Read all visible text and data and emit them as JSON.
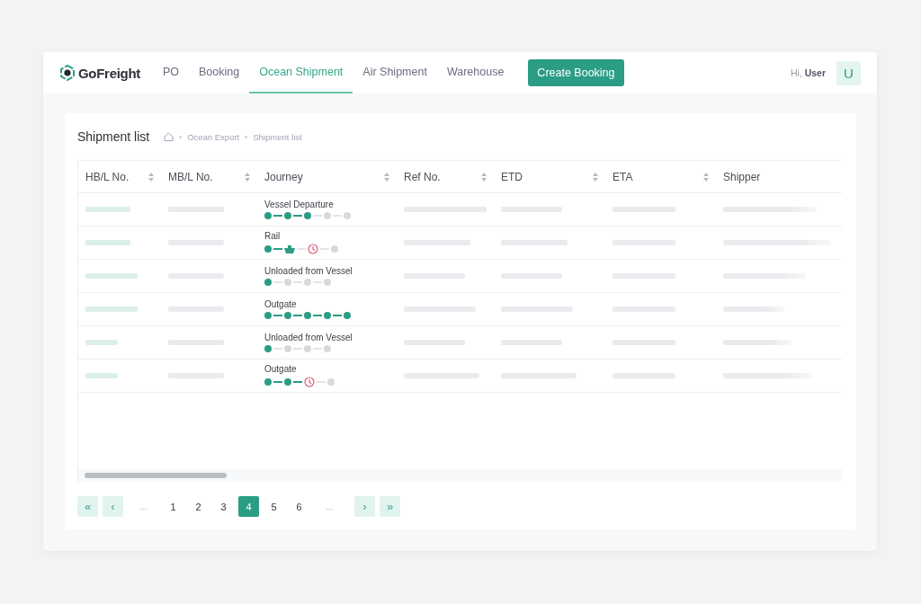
{
  "header": {
    "logo": "GoFreight",
    "tabs": [
      {
        "label": "PO",
        "selected": false
      },
      {
        "label": "Booking",
        "selected": false
      },
      {
        "label": "Ocean Shipment",
        "selected": true
      },
      {
        "label": "Air Shipment",
        "selected": false
      },
      {
        "label": "Warehouse",
        "selected": false
      }
    ],
    "action_button": "Create Booking",
    "greeting": "Hi, **User**",
    "avatar": "U"
  },
  "page": {
    "title": "Shipment list",
    "breadcrumb": [
      "Ocean Export",
      "Shipment list"
    ]
  },
  "table": {
    "columns": [
      {
        "label": "HB/L No.",
        "sortable": true
      },
      {
        "label": "MB/L No.",
        "sortable": true
      },
      {
        "label": "Journey",
        "sortable": true
      },
      {
        "label": "Ref No.",
        "sortable": true
      },
      {
        "label": "ETD",
        "sortable": true
      },
      {
        "label": "ETA",
        "sortable": true
      },
      {
        "label": "Shipper",
        "sortable": false
      }
    ],
    "rows": [
      {
        "journey": "Vessel Departure",
        "steps": [
          {
            "kind": "done"
          },
          {
            "kind": "done"
          },
          {
            "kind": "done"
          },
          {
            "kind": "pending"
          },
          {
            "kind": "pending"
          }
        ]
      },
      {
        "journey": "Rail",
        "steps": [
          {
            "kind": "done"
          },
          {
            "kind": "vessel"
          },
          {
            "kind": "delayed"
          },
          {
            "kind": "pending"
          }
        ]
      },
      {
        "journey": "Unloaded from Vessel",
        "steps": [
          {
            "kind": "done"
          },
          {
            "kind": "pending"
          },
          {
            "kind": "pending"
          },
          {
            "kind": "pending"
          }
        ]
      },
      {
        "journey": "Outgate",
        "steps": [
          {
            "kind": "done"
          },
          {
            "kind": "done"
          },
          {
            "kind": "done"
          },
          {
            "kind": "done"
          },
          {
            "kind": "done"
          }
        ]
      },
      {
        "journey": "Unloaded from Vessel",
        "steps": [
          {
            "kind": "done"
          },
          {
            "kind": "pending"
          },
          {
            "kind": "pending"
          },
          {
            "kind": "pending"
          }
        ]
      },
      {
        "journey": "Outgate",
        "steps": [
          {
            "kind": "done"
          },
          {
            "kind": "done"
          },
          {
            "kind": "delayed"
          },
          {
            "kind": "pending"
          }
        ]
      }
    ]
  },
  "pagination": [
    {
      "kind": "first",
      "label": "«",
      "selected": false
    },
    {
      "kind": "prev",
      "label": "‹",
      "selected": false
    },
    {
      "kind": "ellipsis",
      "label": "...",
      "selected": false
    },
    {
      "kind": "page",
      "label": "1",
      "selected": false
    },
    {
      "kind": "page",
      "label": "2",
      "selected": false
    },
    {
      "kind": "page",
      "label": "3",
      "selected": false
    },
    {
      "kind": "page",
      "label": "4",
      "selected": true
    },
    {
      "kind": "page",
      "label": "5",
      "selected": false
    },
    {
      "kind": "page",
      "label": "6",
      "selected": false
    },
    {
      "kind": "ellipsis",
      "label": "...",
      "selected": false
    },
    {
      "kind": "next",
      "label": "›",
      "selected": false
    },
    {
      "kind": "last",
      "label": "»",
      "selected": false
    }
  ]
}
